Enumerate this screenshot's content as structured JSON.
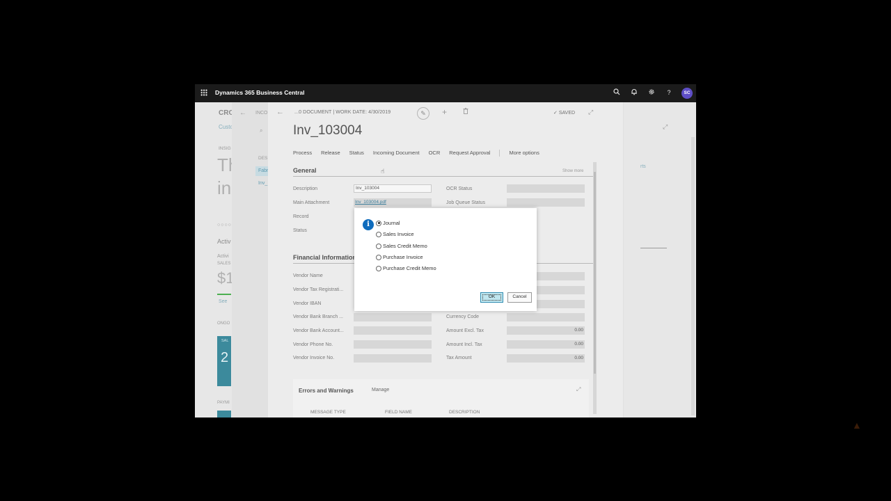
{
  "topbar": {
    "brand": "Dynamics 365 Business Central",
    "avatar": "SC",
    "icons": [
      "waffle-icon",
      "search-icon",
      "bell-icon",
      "gear-icon",
      "help-icon"
    ]
  },
  "background": {
    "title": "CRO",
    "subtitle": "Custo",
    "insight": "INSIG",
    "big1": "Th",
    "big2": "in",
    "dots": "○○○○",
    "activity": "Activ",
    "activity2": "Activi",
    "sales": "SALES",
    "dollar": "$1",
    "see": "See",
    "ongoing": "ONGO",
    "sale_tile": "SAL",
    "tile_num": "2",
    "payment": "PAYMI",
    "l2_inco": "INCO",
    "l2_des": "DES",
    "l2_fab": "Fabr",
    "l2_inv": "Inv_",
    "right_rts": "rts"
  },
  "card": {
    "breadcrumb": "...0 DOCUMENT | WORK DATE: 4/30/2019",
    "saved": "SAVED",
    "title": "Inv_103004",
    "actions": [
      "Process",
      "Release",
      "Status",
      "Incoming Document",
      "OCR",
      "Request Approval"
    ],
    "more_options": "More options",
    "general": "General",
    "show_more": "Show more",
    "fields_left": [
      {
        "label": "Description",
        "value": "Inv_103004"
      },
      {
        "label": "Main Attachment",
        "value": "Inv_103004.pdf"
      },
      {
        "label": "Record",
        "value": ""
      },
      {
        "label": "Status",
        "value": ""
      }
    ],
    "fields_right": [
      {
        "label": "OCR Status",
        "value": ""
      },
      {
        "label": "Job Queue Status",
        "value": ""
      }
    ],
    "financial": "Financial Information",
    "fin_left": [
      {
        "label": "Vendor Name",
        "value": ""
      },
      {
        "label": "Vendor Tax Registrati...",
        "value": ""
      },
      {
        "label": "Vendor IBAN",
        "value": ""
      },
      {
        "label": "Vendor Bank Branch ...",
        "value": ""
      },
      {
        "label": "Vendor Bank Account...",
        "value": ""
      },
      {
        "label": "Vendor Phone No.",
        "value": ""
      },
      {
        "label": "Vendor Invoice No.",
        "value": ""
      }
    ],
    "fin_right": [
      {
        "label": "Currency Code",
        "value": ""
      },
      {
        "label": "Amount Excl. Tax",
        "value": "0.00"
      },
      {
        "label": "Amount Incl. Tax",
        "value": "0.00"
      },
      {
        "label": "Tax Amount",
        "value": "0.00"
      }
    ],
    "errors_title": "Errors and Warnings",
    "manage": "Manage",
    "err_cols": [
      "MESSAGE TYPE",
      "FIELD NAME",
      "DESCRIPTION"
    ]
  },
  "dialog": {
    "options": [
      "Journal",
      "Sales Invoice",
      "Sales Credit Memo",
      "Purchase Invoice",
      "Purchase Credit Memo"
    ],
    "selected": "Journal",
    "ok": "OK",
    "cancel": "Cancel"
  }
}
